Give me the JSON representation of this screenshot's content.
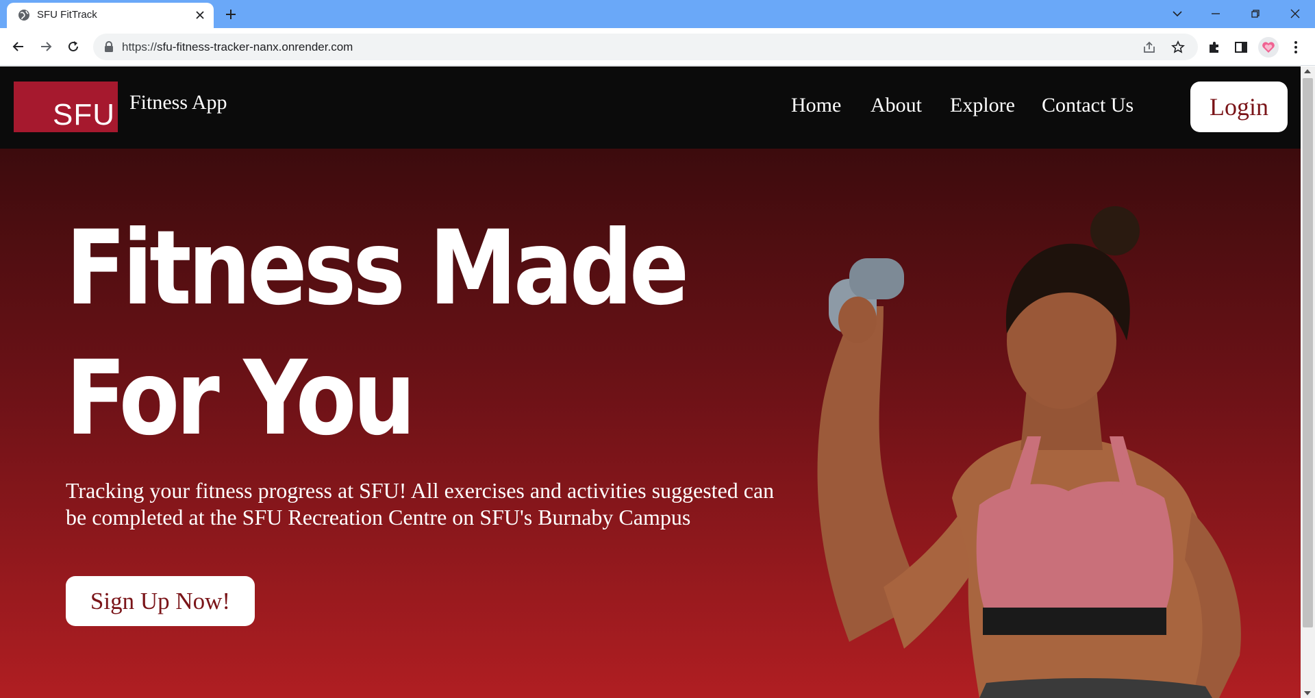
{
  "browser": {
    "tab_title": "SFU FitTrack",
    "url_scheme": "https://",
    "url_host": "sfu-fitness-tracker-nanx.onrender.com",
    "icons": [
      "globe-icon",
      "close-icon",
      "plus-icon",
      "chevron-down-icon",
      "minimize-icon",
      "restore-icon",
      "close-window-icon",
      "back-icon",
      "forward-icon",
      "reload-icon",
      "lock-icon",
      "share-icon",
      "star-icon",
      "extensions-icon",
      "side-panel-icon",
      "menu-icon"
    ],
    "accent_color": "#6aa8f8"
  },
  "site": {
    "logo_text": "SFU",
    "app_name": "Fitness App",
    "nav": [
      "Home",
      "About",
      "Explore",
      "Contact Us"
    ],
    "login_label": "Login",
    "brand_color": "#a6192e"
  },
  "hero": {
    "headline_line1": "Fitness Made",
    "headline_line2": "For You",
    "subtitle": "Tracking your fitness progress at SFU! All exercises and activities suggested can be completed at the SFU Recreation Centre on SFU's Burnaby Campus",
    "cta_label": "Sign Up Now!",
    "gradient_top": "#3c0b0d",
    "gradient_bottom": "#b01e22"
  }
}
